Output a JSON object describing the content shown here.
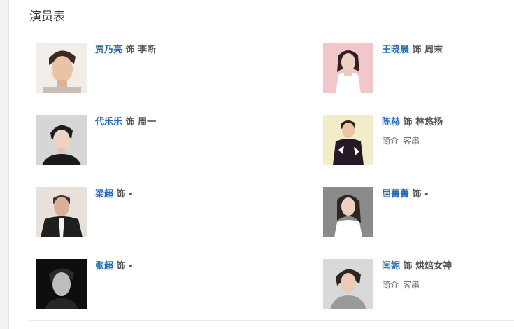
{
  "section": {
    "title": "演员表"
  },
  "cast": [
    {
      "actor": "贾乃亮",
      "shi": "饰",
      "role": "李断",
      "links": []
    },
    {
      "actor": "王晓晨",
      "shi": "饰",
      "role": "周末",
      "links": []
    },
    {
      "actor": "代乐乐",
      "shi": "饰",
      "role": "周一",
      "links": []
    },
    {
      "actor": "陈赫",
      "shi": "饰",
      "role": "林悠扬",
      "links": [
        "简介",
        "客串"
      ]
    },
    {
      "actor": "梁超",
      "shi": "饰",
      "role": "-",
      "links": []
    },
    {
      "actor": "屈菁菁",
      "shi": "饰",
      "role": "-",
      "links": []
    },
    {
      "actor": "张超",
      "shi": "饰",
      "role": "-",
      "links": []
    },
    {
      "actor": "闫妮",
      "shi": "饰",
      "role": "烘焙女神",
      "links": [
        "简介",
        "客串"
      ]
    }
  ],
  "colors": {
    "actor_link": "#2a6cb0",
    "rule": "#cfcfcf"
  }
}
